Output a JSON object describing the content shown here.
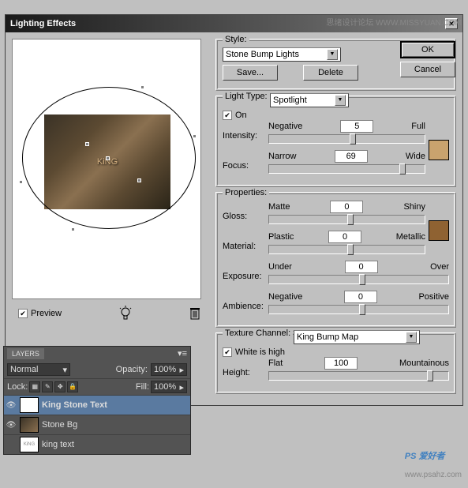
{
  "wm_top": "思绪设计论坛  WWW.MISSYUAN.COM",
  "wm_bottom": "PS 爱好者",
  "wm_url": "www.psahz.com",
  "dialog": {
    "title": "Lighting Effects",
    "ok": "OK",
    "cancel": "Cancel",
    "style_label": "Style:",
    "style_value": "Stone Bump Lights",
    "save": "Save...",
    "delete": "Delete",
    "preview_label": "Preview",
    "preview_text": "KiNG"
  },
  "light": {
    "legend": "Light Type:",
    "type_value": "Spotlight",
    "on": "On",
    "intensity": {
      "label": "Intensity:",
      "left": "Negative",
      "right": "Full",
      "value": "5",
      "pos": 52
    },
    "focus": {
      "label": "Focus:",
      "left": "Narrow",
      "right": "Wide",
      "value": "69",
      "pos": 84
    },
    "color": "#c9a36e"
  },
  "props": {
    "legend": "Properties:",
    "gloss": {
      "label": "Gloss:",
      "left": "Matte",
      "right": "Shiny",
      "value": "0",
      "pos": 50
    },
    "material": {
      "label": "Material:",
      "left": "Plastic",
      "right": "Metallic",
      "value": "0",
      "pos": 50
    },
    "exposure": {
      "label": "Exposure:",
      "left": "Under",
      "right": "Over",
      "value": "0",
      "pos": 50
    },
    "ambience": {
      "label": "Ambience:",
      "left": "Negative",
      "right": "Positive",
      "value": "0",
      "pos": 50
    },
    "color": "#8f6232"
  },
  "texture": {
    "legend": "Texture Channel:",
    "channel_value": "King Bump Map",
    "white": "White is high",
    "height": {
      "label": "Height:",
      "left": "Flat",
      "right": "Mountainous",
      "value": "100",
      "pos": 88
    }
  },
  "layers": {
    "tab": "LAYERS",
    "mode": "Normal",
    "opacity_lbl": "Opacity:",
    "opacity_val": "100%",
    "lock_lbl": "Lock:",
    "fill_lbl": "Fill:",
    "fill_val": "100%",
    "items": [
      {
        "name": "King Stone Text"
      },
      {
        "name": "Stone Bg"
      },
      {
        "name": "king text"
      }
    ]
  }
}
